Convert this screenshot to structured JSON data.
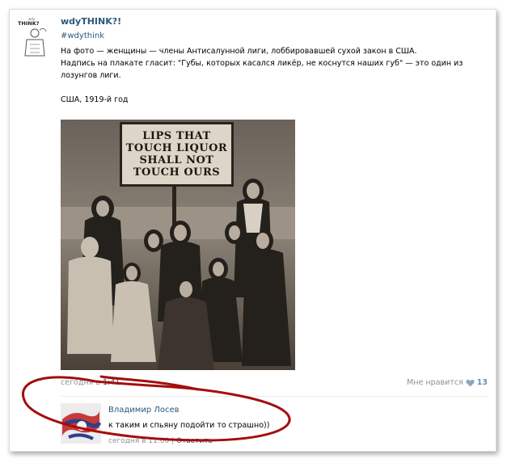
{
  "post": {
    "author": "wdyTHINK?!",
    "hashtag": "#wdythink",
    "avatar_text": "wdy THINK?",
    "lines": [
      "На фото — женщины — члены Антисалунной лиги, лоббировавшей сухой закон в США.",
      "Надпись на плакате гласит: \"Губы, которых касался ликёр, не коснутся наших губ\" — это один из лозунгов лиги.",
      "США, 1919-й год"
    ],
    "photo_sign": [
      "LIPS THAT",
      "TOUCH LIQUOR",
      "SHALL NOT",
      "TOUCH OURS"
    ],
    "time_prefix": "сегодня в",
    "time_value": "1:41",
    "like_label": "Мне нравится",
    "like_count": "13",
    "heart_icon": "heart-icon"
  },
  "comment": {
    "author": "Владимир Лосев",
    "text": "к таким и спьяну подойти то страшно))",
    "time": "сегодня в 11:00",
    "separator": "|",
    "reply_label": "Ответить"
  },
  "colors": {
    "link": "#2b587a",
    "muted": "#8a9299",
    "annotation": "#a40e0e"
  }
}
